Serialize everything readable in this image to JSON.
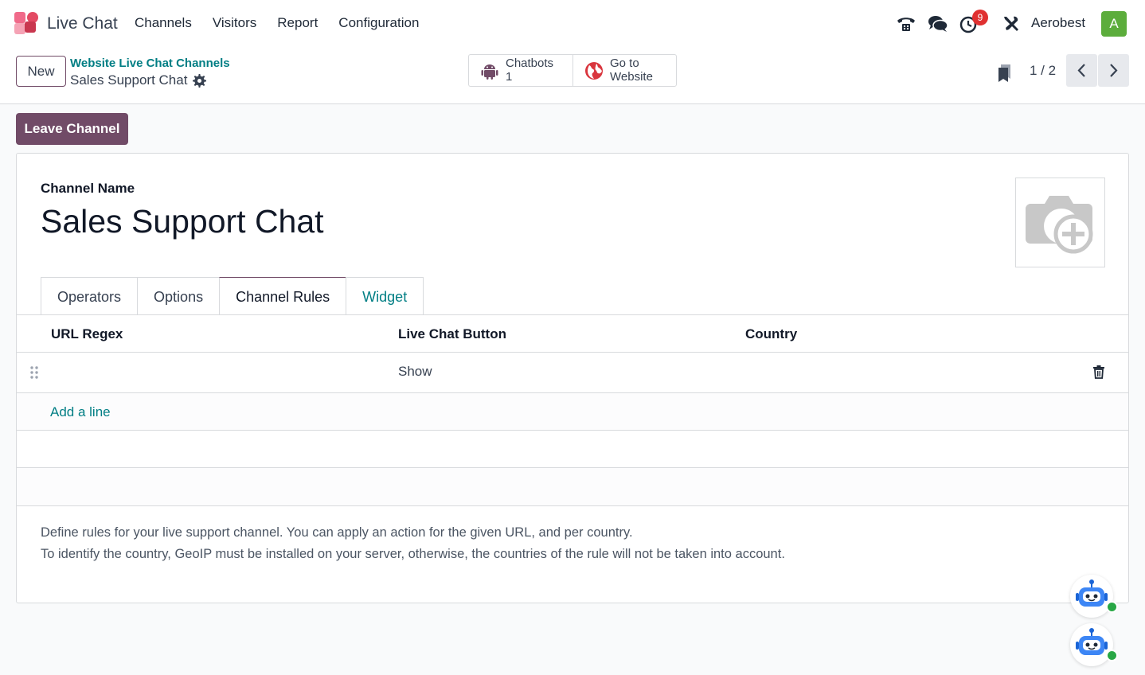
{
  "navbar": {
    "app_name": "Live Chat",
    "menu": [
      "Channels",
      "Visitors",
      "Report",
      "Configuration"
    ],
    "activity_count": "9",
    "company": "Aerobest",
    "avatar_initial": "A"
  },
  "control": {
    "new_label": "New",
    "breadcrumb_parent": "Website Live Chat Channels",
    "breadcrumb_current": "Sales Support Chat",
    "smart_buttons": [
      {
        "label": "Chatbots",
        "value": "1",
        "icon": "android-icon"
      },
      {
        "label": "Go to",
        "value": "Website",
        "icon": "globe-icon"
      }
    ],
    "pager": "1 / 2"
  },
  "actions": {
    "leave_label": "Leave Channel"
  },
  "form": {
    "name_label": "Channel Name",
    "name_value": "Sales Support Chat",
    "tabs": [
      {
        "label": "Operators",
        "active": false
      },
      {
        "label": "Options",
        "active": false
      },
      {
        "label": "Channel Rules",
        "active": true
      },
      {
        "label": "Widget",
        "active": false
      }
    ],
    "rules_table": {
      "columns": [
        "URL Regex",
        "Live Chat Button",
        "Country"
      ],
      "rows": [
        {
          "url_regex": "",
          "button": "Show",
          "country": ""
        }
      ],
      "add_line": "Add a line"
    },
    "help": [
      "Define rules for your live support channel. You can apply an action for the given URL, and per country.",
      "To identify the country, GeoIP must be installed on your server, otherwise, the countries of the rule will not be taken into account."
    ]
  },
  "colors": {
    "primary": "#714b67",
    "link": "#017e84",
    "badge": "#e03131",
    "avatar": "#5cad3c",
    "online": "#28a745"
  }
}
